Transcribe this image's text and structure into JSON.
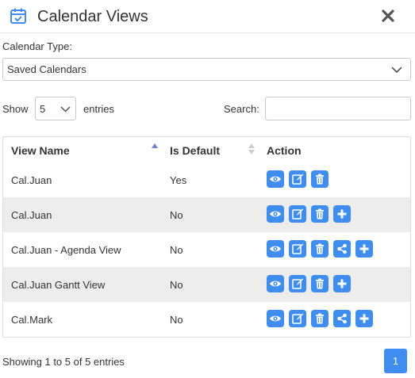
{
  "header": {
    "title": "Calendar Views"
  },
  "calendar_type": {
    "label": "Calendar Type:",
    "selected": "Saved Calendars"
  },
  "length": {
    "label_before": "Show",
    "selected": "5",
    "label_after": "entries"
  },
  "search": {
    "label": "Search:",
    "value": ""
  },
  "table": {
    "columns": [
      "View Name",
      "Is Default",
      "Action"
    ],
    "rows": [
      {
        "name": "Cal.Juan",
        "is_default": "Yes",
        "actions": [
          "eye",
          "edit",
          "trash"
        ]
      },
      {
        "name": "Cal.Juan",
        "is_default": "No",
        "actions": [
          "eye",
          "edit",
          "trash",
          "plus"
        ]
      },
      {
        "name": "Cal.Juan - Agenda View",
        "is_default": "No",
        "actions": [
          "eye",
          "edit",
          "trash",
          "share",
          "plus"
        ]
      },
      {
        "name": "Cal.Juan Gantt View",
        "is_default": "No",
        "actions": [
          "eye",
          "edit",
          "trash",
          "plus"
        ]
      },
      {
        "name": "Cal.Mark",
        "is_default": "No",
        "actions": [
          "eye",
          "edit",
          "trash",
          "share",
          "plus"
        ]
      }
    ]
  },
  "footer": {
    "info": "Showing 1 to 5 of 5 entries",
    "page": "1"
  },
  "colors": {
    "accent": "#3d8ef0",
    "stripe": "#ededed",
    "icon_header": "#3d8ef0"
  }
}
